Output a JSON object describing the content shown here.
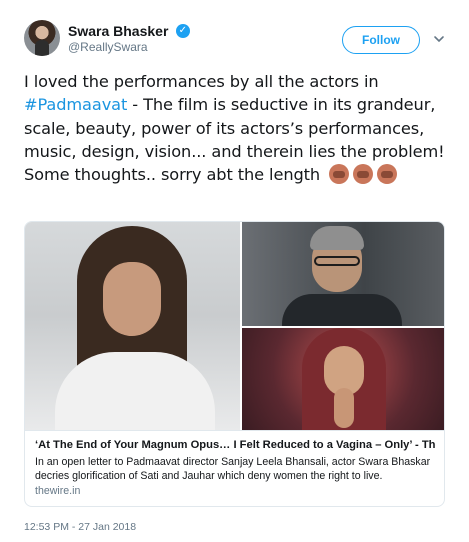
{
  "user": {
    "display_name": "Swara Bhasker",
    "handle": "@ReallySwara",
    "verified_icon": "verified-badge-icon"
  },
  "actions": {
    "follow_label": "Follow",
    "more_icon": "chevron-down-icon"
  },
  "tweet": {
    "text_before": "I loved the performances by all the actors in",
    "hashtag": "#Padmaavat",
    "text_after": "- The film is seductive in its grandeur, scale, beauty, power of its actors’s performances, music, design, vision... and therein lies the problem! Some thoughts.. sorry abt the length",
    "emojis": [
      "see-no-evil-monkey-emoji",
      "see-no-evil-monkey-emoji",
      "see-no-evil-monkey-emoji"
    ]
  },
  "card": {
    "title": "‘At The End of Your Magnum Opus… I Felt Reduced to a Vagina – Only’ - The ...",
    "description": "In an open letter to Padmaavat director Sanjay Leela Bhansali, actor Swara Bhaskar decries glorification of Sati and Jauhar which deny women the right to live.",
    "domain": "thewire.in"
  },
  "meta": {
    "timestamp": "12:53 PM - 27 Jan 2018"
  },
  "colors": {
    "accent": "#1da1f2",
    "hashtag": "#1b95e0",
    "secondary_text": "#657786",
    "border": "#e1e8ed"
  }
}
